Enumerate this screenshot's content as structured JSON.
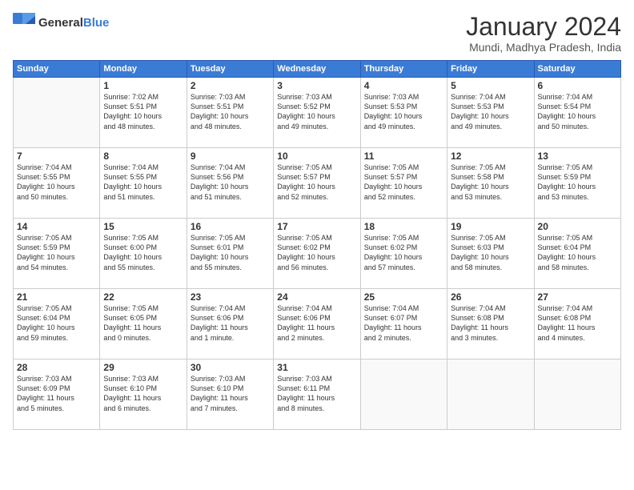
{
  "logo": {
    "general": "General",
    "blue": "Blue"
  },
  "header": {
    "month": "January 2024",
    "location": "Mundi, Madhya Pradesh, India"
  },
  "days_of_week": [
    "Sunday",
    "Monday",
    "Tuesday",
    "Wednesday",
    "Thursday",
    "Friday",
    "Saturday"
  ],
  "weeks": [
    [
      {
        "day": "",
        "info": ""
      },
      {
        "day": "1",
        "info": "Sunrise: 7:02 AM\nSunset: 5:51 PM\nDaylight: 10 hours\nand 48 minutes."
      },
      {
        "day": "2",
        "info": "Sunrise: 7:03 AM\nSunset: 5:51 PM\nDaylight: 10 hours\nand 48 minutes."
      },
      {
        "day": "3",
        "info": "Sunrise: 7:03 AM\nSunset: 5:52 PM\nDaylight: 10 hours\nand 49 minutes."
      },
      {
        "day": "4",
        "info": "Sunrise: 7:03 AM\nSunset: 5:53 PM\nDaylight: 10 hours\nand 49 minutes."
      },
      {
        "day": "5",
        "info": "Sunrise: 7:04 AM\nSunset: 5:53 PM\nDaylight: 10 hours\nand 49 minutes."
      },
      {
        "day": "6",
        "info": "Sunrise: 7:04 AM\nSunset: 5:54 PM\nDaylight: 10 hours\nand 50 minutes."
      }
    ],
    [
      {
        "day": "7",
        "info": "Sunrise: 7:04 AM\nSunset: 5:55 PM\nDaylight: 10 hours\nand 50 minutes."
      },
      {
        "day": "8",
        "info": "Sunrise: 7:04 AM\nSunset: 5:55 PM\nDaylight: 10 hours\nand 51 minutes."
      },
      {
        "day": "9",
        "info": "Sunrise: 7:04 AM\nSunset: 5:56 PM\nDaylight: 10 hours\nand 51 minutes."
      },
      {
        "day": "10",
        "info": "Sunrise: 7:05 AM\nSunset: 5:57 PM\nDaylight: 10 hours\nand 52 minutes."
      },
      {
        "day": "11",
        "info": "Sunrise: 7:05 AM\nSunset: 5:57 PM\nDaylight: 10 hours\nand 52 minutes."
      },
      {
        "day": "12",
        "info": "Sunrise: 7:05 AM\nSunset: 5:58 PM\nDaylight: 10 hours\nand 53 minutes."
      },
      {
        "day": "13",
        "info": "Sunrise: 7:05 AM\nSunset: 5:59 PM\nDaylight: 10 hours\nand 53 minutes."
      }
    ],
    [
      {
        "day": "14",
        "info": "Sunrise: 7:05 AM\nSunset: 5:59 PM\nDaylight: 10 hours\nand 54 minutes."
      },
      {
        "day": "15",
        "info": "Sunrise: 7:05 AM\nSunset: 6:00 PM\nDaylight: 10 hours\nand 55 minutes."
      },
      {
        "day": "16",
        "info": "Sunrise: 7:05 AM\nSunset: 6:01 PM\nDaylight: 10 hours\nand 55 minutes."
      },
      {
        "day": "17",
        "info": "Sunrise: 7:05 AM\nSunset: 6:02 PM\nDaylight: 10 hours\nand 56 minutes."
      },
      {
        "day": "18",
        "info": "Sunrise: 7:05 AM\nSunset: 6:02 PM\nDaylight: 10 hours\nand 57 minutes."
      },
      {
        "day": "19",
        "info": "Sunrise: 7:05 AM\nSunset: 6:03 PM\nDaylight: 10 hours\nand 58 minutes."
      },
      {
        "day": "20",
        "info": "Sunrise: 7:05 AM\nSunset: 6:04 PM\nDaylight: 10 hours\nand 58 minutes."
      }
    ],
    [
      {
        "day": "21",
        "info": "Sunrise: 7:05 AM\nSunset: 6:04 PM\nDaylight: 10 hours\nand 59 minutes."
      },
      {
        "day": "22",
        "info": "Sunrise: 7:05 AM\nSunset: 6:05 PM\nDaylight: 11 hours\nand 0 minutes."
      },
      {
        "day": "23",
        "info": "Sunrise: 7:04 AM\nSunset: 6:06 PM\nDaylight: 11 hours\nand 1 minute."
      },
      {
        "day": "24",
        "info": "Sunrise: 7:04 AM\nSunset: 6:06 PM\nDaylight: 11 hours\nand 2 minutes."
      },
      {
        "day": "25",
        "info": "Sunrise: 7:04 AM\nSunset: 6:07 PM\nDaylight: 11 hours\nand 2 minutes."
      },
      {
        "day": "26",
        "info": "Sunrise: 7:04 AM\nSunset: 6:08 PM\nDaylight: 11 hours\nand 3 minutes."
      },
      {
        "day": "27",
        "info": "Sunrise: 7:04 AM\nSunset: 6:08 PM\nDaylight: 11 hours\nand 4 minutes."
      }
    ],
    [
      {
        "day": "28",
        "info": "Sunrise: 7:03 AM\nSunset: 6:09 PM\nDaylight: 11 hours\nand 5 minutes."
      },
      {
        "day": "29",
        "info": "Sunrise: 7:03 AM\nSunset: 6:10 PM\nDaylight: 11 hours\nand 6 minutes."
      },
      {
        "day": "30",
        "info": "Sunrise: 7:03 AM\nSunset: 6:10 PM\nDaylight: 11 hours\nand 7 minutes."
      },
      {
        "day": "31",
        "info": "Sunrise: 7:03 AM\nSunset: 6:11 PM\nDaylight: 11 hours\nand 8 minutes."
      },
      {
        "day": "",
        "info": ""
      },
      {
        "day": "",
        "info": ""
      },
      {
        "day": "",
        "info": ""
      }
    ]
  ]
}
